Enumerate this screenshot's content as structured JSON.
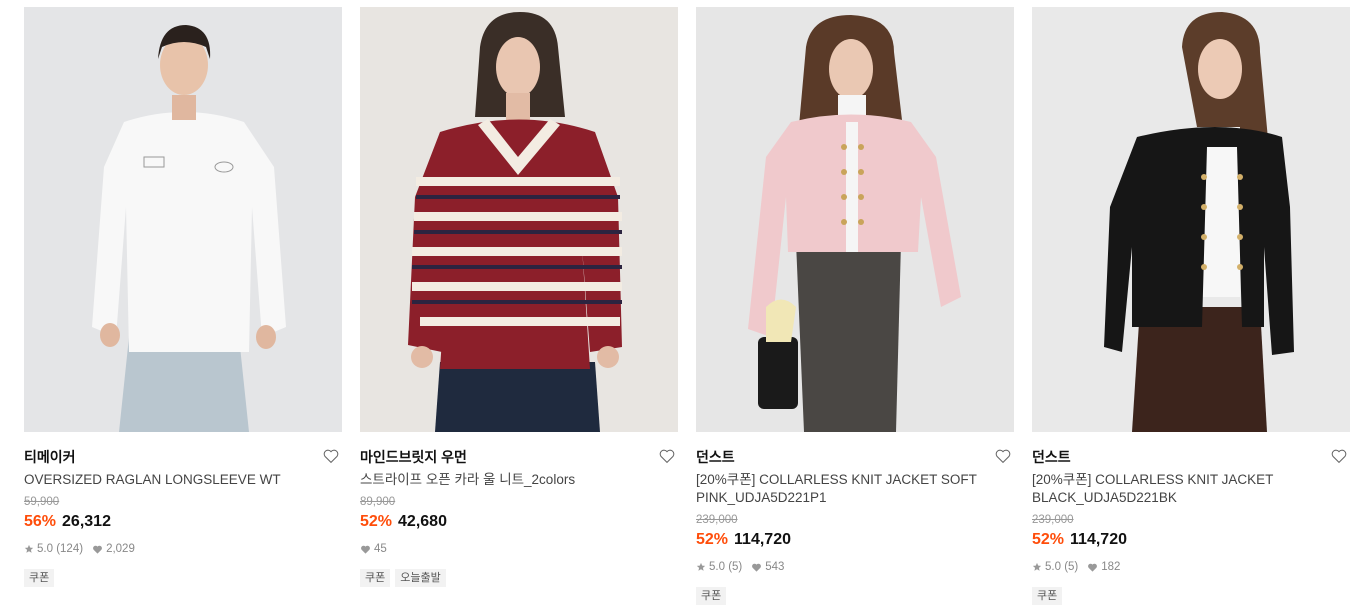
{
  "products": [
    {
      "brand": "티메이커",
      "name": "OVERSIZED RAGLAN LONGSLEEVE WT",
      "original_price": "59,900",
      "discount": "56%",
      "price": "26,312",
      "rating": "5.0",
      "review_count": "(124)",
      "likes": "2,029",
      "tags": [
        "쿠폰"
      ]
    },
    {
      "brand": "마인드브릿지 우먼",
      "name": "스트라이프 오픈 카라 울 니트_2colors",
      "original_price": "89,900",
      "discount": "52%",
      "price": "42,680",
      "likes": "45",
      "tags": [
        "쿠폰",
        "오늘출발"
      ]
    },
    {
      "brand": "던스트",
      "name": "[20%쿠폰] COLLARLESS KNIT JACKET SOFT PINK_UDJA5D221P1",
      "original_price": "239,000",
      "discount": "52%",
      "price": "114,720",
      "rating": "5.0",
      "review_count": "(5)",
      "likes": "543",
      "tags": [
        "쿠폰"
      ]
    },
    {
      "brand": "던스트",
      "name": "[20%쿠폰] COLLARLESS KNIT JACKET BLACK_UDJA5D221BK",
      "original_price": "239,000",
      "discount": "52%",
      "price": "114,720",
      "rating": "5.0",
      "review_count": "(5)",
      "likes": "182",
      "tags": [
        "쿠폰"
      ]
    }
  ],
  "colors": {
    "discount": "#ff4d0a",
    "text": "#111111",
    "muted": "#888888"
  },
  "icons": {
    "wishlist": "heart-outline-icon",
    "rating": "star-icon",
    "likes": "heart-filled-icon"
  }
}
